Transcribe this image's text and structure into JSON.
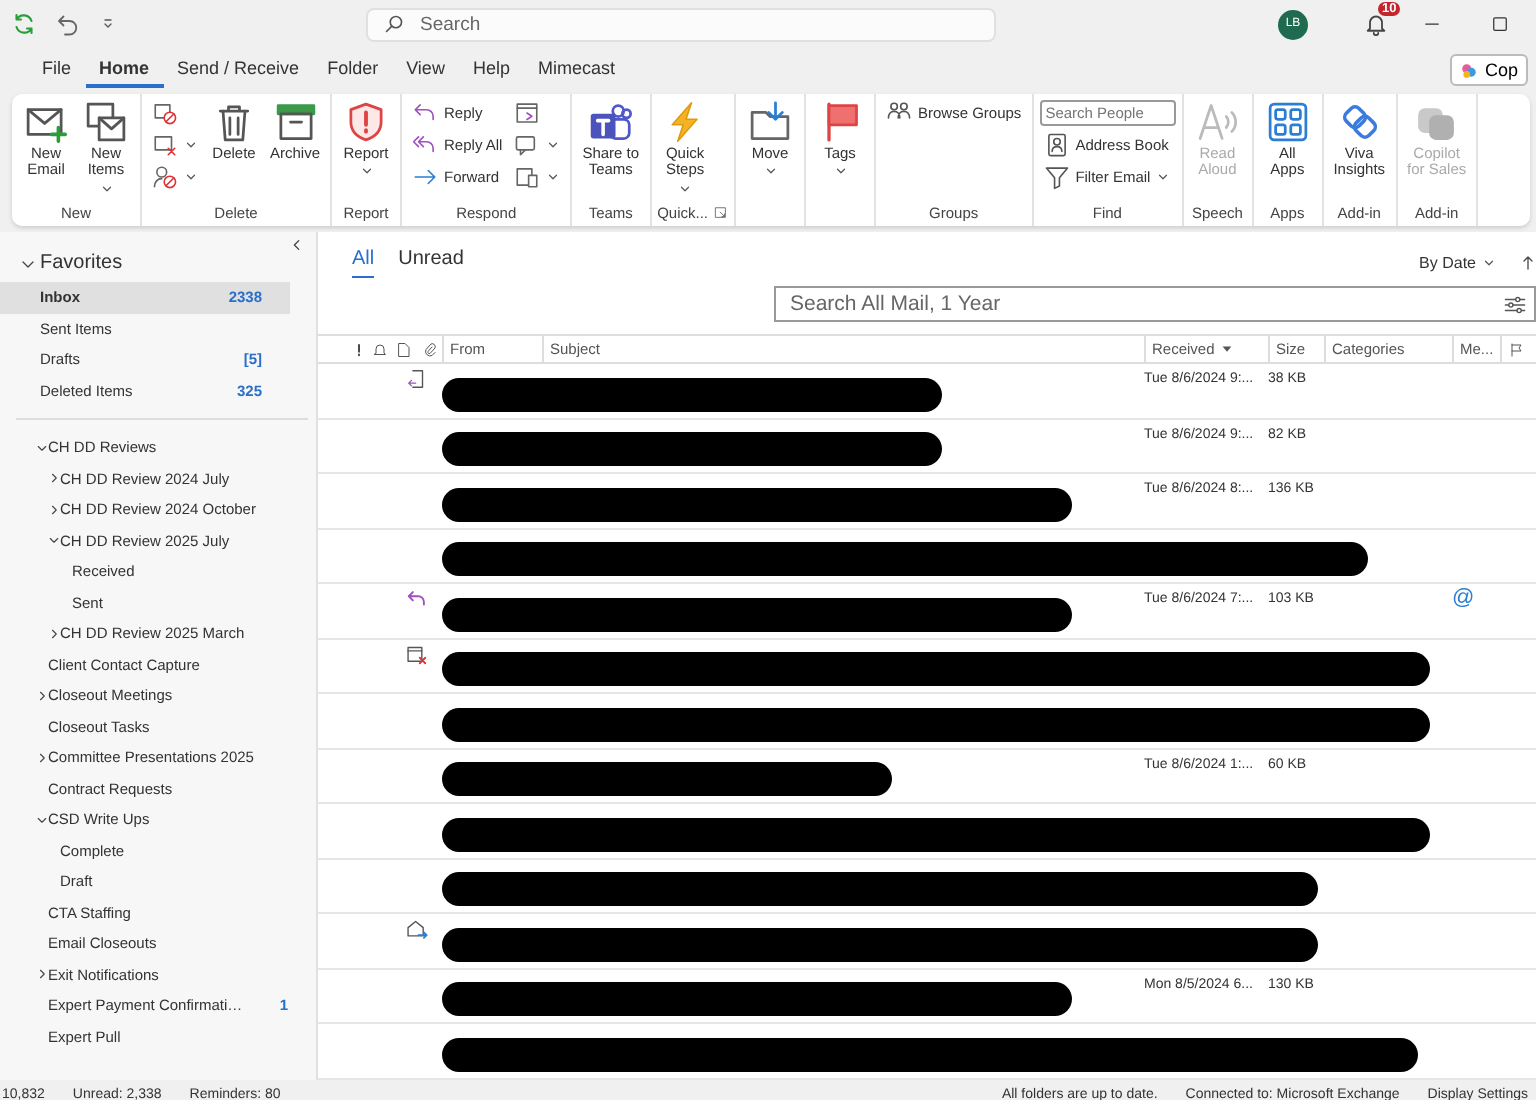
{
  "title_bar": {
    "search_placeholder": "Search",
    "avatar_initials": "LB",
    "notification_count": "10"
  },
  "menu_tabs": [
    {
      "label": "File",
      "selected": false
    },
    {
      "label": "Home",
      "selected": true
    },
    {
      "label": "Send / Receive",
      "selected": false
    },
    {
      "label": "Folder",
      "selected": false
    },
    {
      "label": "View",
      "selected": false
    },
    {
      "label": "Help",
      "selected": false
    },
    {
      "label": "Mimecast",
      "selected": false
    }
  ],
  "copilot_button": {
    "label": "Cop"
  },
  "ribbon": {
    "groups": [
      {
        "label": "New",
        "launcher": false,
        "columns": [
          [
            {
              "kind": "large",
              "lines": [
                "New",
                "Email"
              ],
              "dropdown": false,
              "disabled": false
            }
          ],
          [
            {
              "kind": "large",
              "lines": [
                "New",
                "Items"
              ],
              "dropdown": true,
              "disabled": false
            }
          ]
        ]
      },
      {
        "label": "Delete",
        "launcher": false,
        "columns": [
          [
            {
              "kind": "small",
              "dropdown": false
            },
            {
              "kind": "small",
              "dropdown": true
            },
            {
              "kind": "small",
              "dropdown": true
            }
          ],
          [
            {
              "kind": "large",
              "lines": [
                "Delete"
              ],
              "dropdown": false,
              "disabled": false
            }
          ],
          [
            {
              "kind": "large",
              "lines": [
                "Archive"
              ],
              "dropdown": false,
              "disabled": false
            }
          ]
        ]
      },
      {
        "label": "Report",
        "launcher": false,
        "columns": [
          [
            {
              "kind": "large",
              "lines": [
                "Report"
              ],
              "dropdown": true,
              "disabled": false
            }
          ]
        ]
      },
      {
        "label": "Respond",
        "launcher": false,
        "columns": [
          [
            {
              "kind": "small",
              "label": "Reply",
              "dropdown": false
            },
            {
              "kind": "small",
              "label": "Reply All",
              "dropdown": false
            },
            {
              "kind": "small",
              "label": "Forward",
              "dropdown": false
            }
          ],
          [
            {
              "kind": "small",
              "dropdown": false
            },
            {
              "kind": "small",
              "dropdown": true
            },
            {
              "kind": "small",
              "dropdown": true
            }
          ]
        ]
      },
      {
        "label": "Teams",
        "launcher": false,
        "columns": [
          [
            {
              "kind": "large",
              "lines": [
                "Share to",
                "Teams"
              ],
              "dropdown": false,
              "disabled": false
            }
          ]
        ]
      },
      {
        "label": "Quick...",
        "launcher": true,
        "columns": [
          [
            {
              "kind": "large",
              "lines": [
                "Quick",
                "Steps"
              ],
              "dropdown": true,
              "disabled": false
            }
          ]
        ]
      },
      {
        "launcher": false,
        "columns": [
          [
            {
              "kind": "large",
              "lines": [
                "Move"
              ],
              "dropdown": true,
              "disabled": false
            }
          ]
        ]
      },
      {
        "launcher": false,
        "columns": [
          [
            {
              "kind": "large",
              "lines": [
                "Tags"
              ],
              "dropdown": true,
              "disabled": false
            }
          ]
        ]
      },
      {
        "label": "Groups",
        "launcher": false,
        "columns": [
          [
            {
              "kind": "small",
              "label": "Browse Groups",
              "dropdown": false
            }
          ]
        ]
      },
      {
        "label": "Find",
        "launcher": false,
        "columns": [
          [
            {
              "kind": "field",
              "placeholder": "Search People"
            },
            {
              "kind": "small",
              "label": "Address Book",
              "dropdown": false
            },
            {
              "kind": "small",
              "label": "Filter Email",
              "dropdown": true
            }
          ]
        ]
      },
      {
        "label": "Speech",
        "launcher": false,
        "columns": [
          [
            {
              "kind": "large",
              "lines": [
                "Read",
                "Aloud"
              ],
              "dropdown": false,
              "disabled": true
            }
          ]
        ]
      },
      {
        "label": "Apps",
        "launcher": false,
        "columns": [
          [
            {
              "kind": "large",
              "lines": [
                "All",
                "Apps"
              ],
              "dropdown": false,
              "disabled": false
            }
          ]
        ]
      },
      {
        "label": "Add-in",
        "launcher": false,
        "columns": [
          [
            {
              "kind": "large",
              "lines": [
                "Viva",
                "Insights"
              ],
              "dropdown": false,
              "disabled": false
            }
          ]
        ]
      },
      {
        "label": "Add-in",
        "launcher": false,
        "columns": [
          [
            {
              "kind": "large",
              "lines": [
                "Copilot",
                "for Sales"
              ],
              "dropdown": false,
              "disabled": true
            }
          ]
        ]
      }
    ]
  },
  "favorites": {
    "label": "Favorites",
    "expanded": true,
    "items": [
      {
        "name": "Inbox",
        "count": "2338",
        "selected": true
      },
      {
        "name": "Sent Items",
        "selected": false
      },
      {
        "name": "Drafts",
        "count": "[5]",
        "selected": false
      },
      {
        "name": "Deleted Items",
        "count": "325",
        "selected": false
      }
    ]
  },
  "folders": [
    {
      "name": "CH DD Reviews",
      "expanded": true,
      "children": [
        {
          "name": "CH DD Review 2024 July",
          "expanded": false
        },
        {
          "name": "CH DD Review 2024 October",
          "expanded": false
        },
        {
          "name": "CH DD Review 2025 July",
          "expanded": true,
          "children": [
            {
              "name": "Received"
            },
            {
              "name": "Sent"
            }
          ]
        },
        {
          "name": "CH DD Review 2025 March",
          "expanded": false
        }
      ]
    },
    {
      "name": "Client Contact Capture"
    },
    {
      "name": "Closeout Meetings",
      "expanded": false
    },
    {
      "name": "Closeout Tasks"
    },
    {
      "name": "Committee Presentations 2025",
      "expanded": false
    },
    {
      "name": "Contract Requests"
    },
    {
      "name": "CSD Write Ups",
      "expanded": true,
      "children": [
        {
          "name": "Complete"
        },
        {
          "name": "Draft"
        }
      ]
    },
    {
      "name": "CTA Staffing"
    },
    {
      "name": "Email Closeouts"
    },
    {
      "name": "Exit Notifications",
      "expanded": false
    },
    {
      "name": "Expert Payment Confirmati…",
      "count": "1"
    },
    {
      "name": "Expert Pull"
    }
  ],
  "mail_list": {
    "filters": [
      {
        "label": "All",
        "selected": true
      },
      {
        "label": "Unread",
        "selected": false
      }
    ],
    "sort": "By Date",
    "search_placeholder": "Search All Mail, 1 Year",
    "columns": {
      "from": "From",
      "subject": "Subject",
      "received": "Received",
      "size": "Size",
      "categories": "Categories",
      "mentions": "Me..."
    },
    "rows": [
      {
        "kind": "meeting-forward",
        "received": "Tue 8/6/2024 9:...",
        "size": "38 KB"
      },
      {
        "kind": "plain",
        "received": "Tue 8/6/2024 9:...",
        "size": "82 KB"
      },
      {
        "kind": "plain",
        "received": "Tue 8/6/2024 8:...",
        "size": "136 KB"
      },
      {
        "kind": "plain"
      },
      {
        "kind": "replied",
        "received": "Tue 8/6/2024 7:...",
        "size": "103 KB",
        "mention": "@"
      },
      {
        "kind": "meeting-cancelled"
      },
      {
        "kind": "plain"
      },
      {
        "kind": "plain",
        "received": "Tue 8/6/2024 1:...",
        "size": "60 KB"
      },
      {
        "kind": "plain"
      },
      {
        "kind": "plain"
      },
      {
        "kind": "forwarded"
      },
      {
        "kind": "plain",
        "received": "Mon 8/5/2024 6...",
        "size": "130 KB"
      },
      {
        "kind": "plain"
      }
    ]
  },
  "status_bar": {
    "items": "10,832",
    "unread": "Unread: 2,338",
    "reminders": "Reminders: 80",
    "sync": "All folders are up to date.",
    "connection": "Connected to: Microsoft Exchange",
    "display_settings": "Display Settings"
  }
}
